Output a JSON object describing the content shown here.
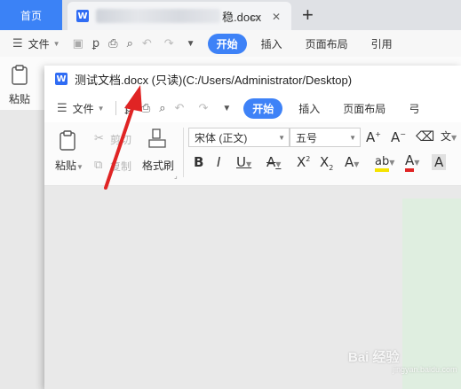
{
  "background_window": {
    "home_tab": "首页",
    "doc_tab_suffix": "稳.docx",
    "menu": {
      "file": "文件",
      "tabs": [
        "开始",
        "插入",
        "页面布局",
        "引用"
      ]
    },
    "paste": "粘贴"
  },
  "read_only_window": {
    "title": "测试文档.docx (只读)(C:/Users/Administrator/Desktop)",
    "menu": {
      "file": "文件",
      "tabs": [
        "开始",
        "插入",
        "页面布局"
      ],
      "overflow_tab": "弓"
    },
    "ribbon": {
      "paste": "粘贴",
      "cut": "剪切",
      "copy": "复制",
      "format_painter": "格式刷",
      "font_name": "宋体 (正文)",
      "font_size": "五号"
    }
  },
  "watermark": {
    "text": "Bai 经验",
    "url": "jingyan.baidu.com"
  },
  "colors": {
    "accent_blue": "#3e82f7",
    "arrow_red": "#e02424",
    "highlight_yellow": "#f5e300",
    "font_color_red": "#e02424"
  }
}
